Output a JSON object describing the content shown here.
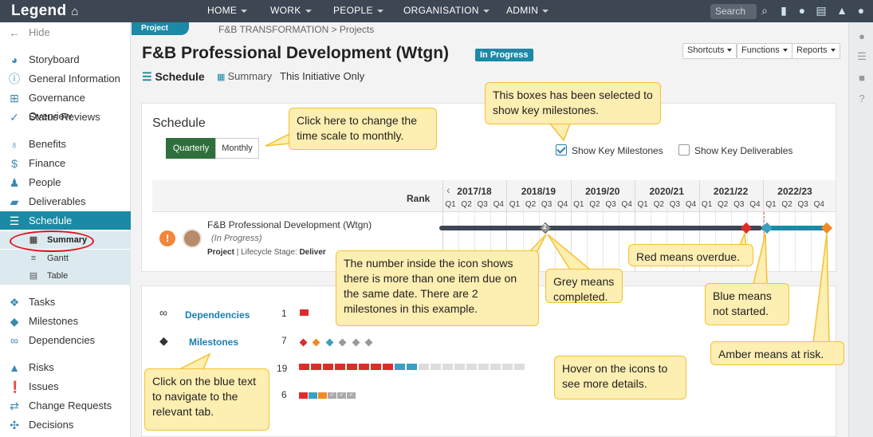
{
  "app": {
    "logo": "Legend"
  },
  "nav": {
    "items": [
      "HOME",
      "WORK",
      "PEOPLE",
      "ORGANISATION",
      "ADMIN"
    ],
    "search_placeholder": "Search"
  },
  "sidebar": {
    "hide": "Hide",
    "items": [
      {
        "label": "Storyboard",
        "icon": "palette-icon"
      },
      {
        "label": "General Information",
        "icon": "info-icon"
      },
      {
        "label": "Governance Overview",
        "icon": "governance-icon"
      },
      {
        "label": "Status Reviews",
        "icon": "check-icon"
      },
      {
        "label": "Benefits",
        "icon": "ribbon-icon"
      },
      {
        "label": "Finance",
        "icon": "dollar-icon"
      },
      {
        "label": "People",
        "icon": "people-icon"
      },
      {
        "label": "Deliverables",
        "icon": "truck-icon"
      },
      {
        "label": "Schedule",
        "icon": "schedule-icon"
      },
      {
        "label": "Tasks",
        "icon": "tasks-icon"
      },
      {
        "label": "Milestones",
        "icon": "diamond-icon"
      },
      {
        "label": "Dependencies",
        "icon": "link-icon"
      },
      {
        "label": "Risks",
        "icon": "warning-icon"
      },
      {
        "label": "Issues",
        "icon": "exclamation-icon"
      },
      {
        "label": "Change Requests",
        "icon": "change-icon"
      },
      {
        "label": "Decisions",
        "icon": "decision-icon"
      }
    ],
    "sub_items": [
      "Summary",
      "Gantt",
      "Table"
    ]
  },
  "header": {
    "project_tab": "Project",
    "breadcrumb": "F&B TRANSFORMATION > Projects",
    "title": "F&B Professional Development (Wtgn)",
    "status": "In Progress",
    "buttons": [
      "Shortcuts",
      "Functions",
      "Reports"
    ],
    "view_tabs": [
      "Schedule",
      "Summary",
      "This Initiative Only"
    ]
  },
  "schedule": {
    "title": "Schedule",
    "scale_options": [
      "Quarterly",
      "Monthly"
    ],
    "checkbox_milestones": "Show Key Milestones",
    "checkbox_deliverables": "Show Key Deliverables",
    "rank_label": "Rank",
    "years": [
      "2017/18",
      "2018/19",
      "2019/20",
      "2020/21",
      "2021/22",
      "2022/23"
    ],
    "quarters": [
      "Q1",
      "Q2",
      "Q3",
      "Q4"
    ],
    "row": {
      "name": "F&B Professional Development (Wtgn)",
      "status": "(In Progress)",
      "meta_type": "Project",
      "meta_text": "| Lifecycle Stage:",
      "meta_stage": "Deliver",
      "grey_count": "2"
    }
  },
  "summary": {
    "rows": [
      {
        "label": "Dependencies",
        "count": "1"
      },
      {
        "label": "Milestones",
        "count": "7"
      },
      {
        "label": "",
        "count": "19"
      },
      {
        "label": "",
        "count": "6"
      }
    ]
  },
  "callouts": {
    "time_scale": "Click here to change the time scale to monthly.",
    "boxes": "This boxes has been selected to show key milestones.",
    "red": "Red means overdue.",
    "number": "The number inside the icon shows there is more than one item due on the same date.  There are 2 milestones in this example.",
    "grey": "Grey means completed.",
    "blue": "Blue means not started.",
    "amber": "Amber means at risk.",
    "blue_text": "Click on the blue text to navigate to the relevant tab.",
    "hover": "Hover on the icons to see more details."
  },
  "colors": {
    "accent": "#1a8aa6",
    "overdue": "#e02b2b",
    "not_started": "#3aa0c0",
    "at_risk": "#f08a24",
    "completed": "#9a9a9a"
  }
}
